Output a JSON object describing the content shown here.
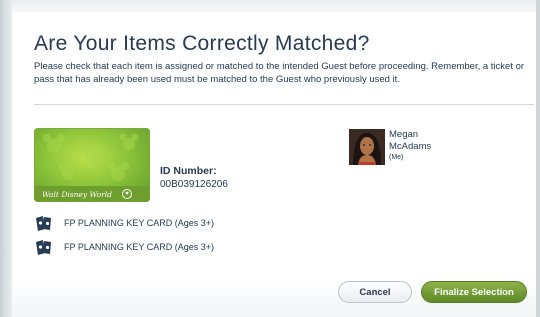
{
  "dialog": {
    "title": "Are Your Items Correctly Matched?",
    "instructions": "Please check that each item is assigned or matched to the intended Guest before proceeding. Remember, a ticket or pass that has already been used must be matched to the Guest who previously used it."
  },
  "item": {
    "card_brand": "Walt Disney World",
    "id_label": "ID Number:",
    "id_value": "00B039126206",
    "card_color": "#8cc43a"
  },
  "guest": {
    "first_name": "Megan",
    "last_name": "McAdams",
    "relation": "(Me)"
  },
  "fastpass_items": [
    {
      "label": "FP PLANNING KEY CARD (Ages 3+)",
      "icon": "fastpass-card-icon"
    },
    {
      "label": "FP PLANNING KEY CARD (Ages 3+)",
      "icon": "fastpass-card-icon"
    }
  ],
  "actions": {
    "cancel_label": "Cancel",
    "finalize_label": "Finalize Selection",
    "finalize_color": "#6f9a32"
  },
  "colors": {
    "text": "#253b56",
    "backdrop": "#e6ebee"
  }
}
